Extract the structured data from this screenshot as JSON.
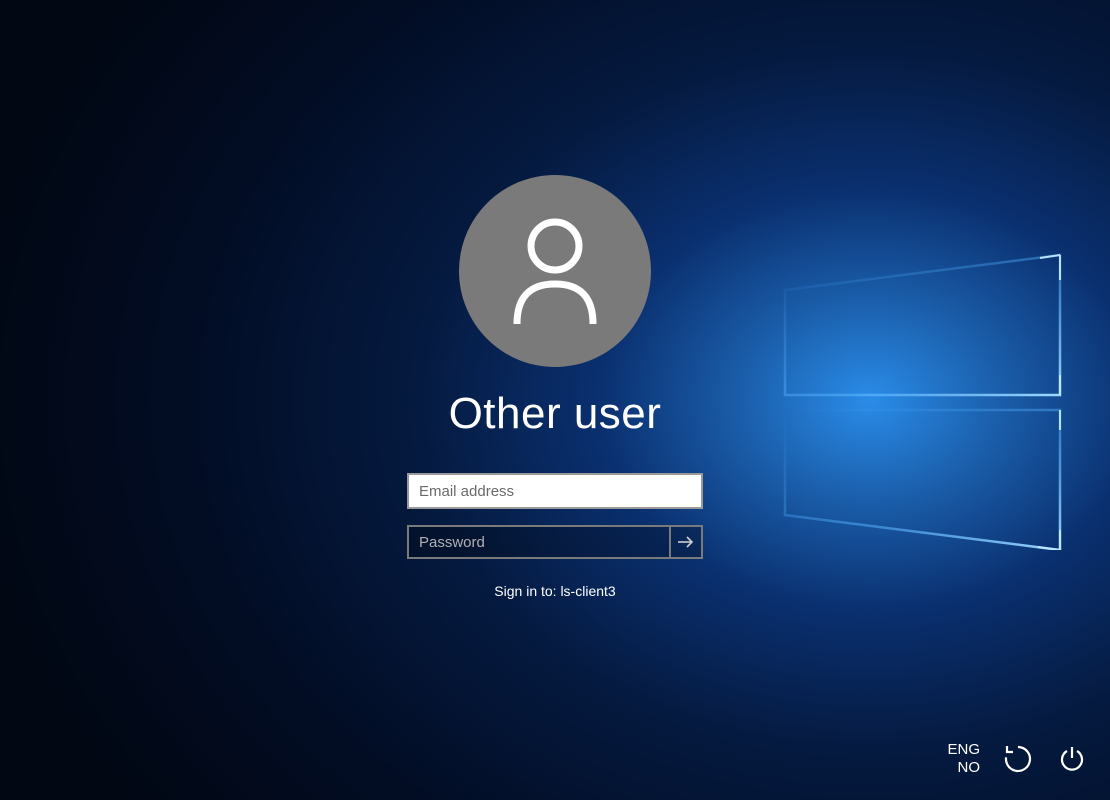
{
  "login": {
    "user_title": "Other user",
    "email_placeholder": "Email address",
    "password_placeholder": "Password",
    "signin_to_text": "Sign in to: ls-client3"
  },
  "bottom_bar": {
    "language_line1": "ENG",
    "language_line2": "NO"
  }
}
